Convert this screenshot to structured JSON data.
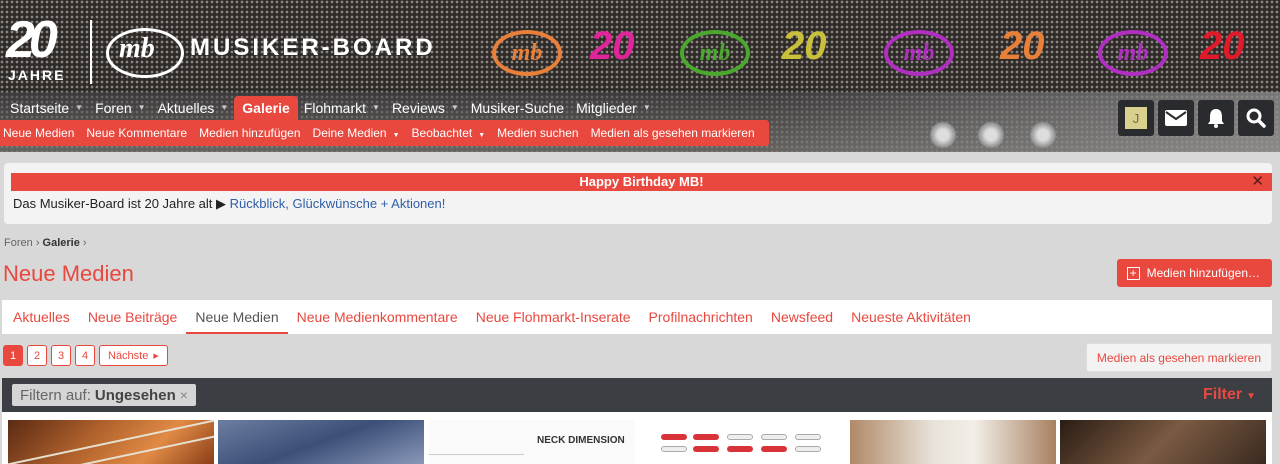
{
  "header": {
    "anniversary_number": "20",
    "anniversary_word": "JAHRE",
    "brand_mark": "mb",
    "brand_name": "MUSIKER-BOARD",
    "accent_color": "#e8483e"
  },
  "nav": {
    "items": [
      {
        "label": "Startseite"
      },
      {
        "label": "Foren"
      },
      {
        "label": "Aktuelles"
      },
      {
        "label": "Galerie",
        "active": true
      },
      {
        "label": "Flohmarkt"
      },
      {
        "label": "Reviews"
      },
      {
        "label": "Musiker-Suche"
      },
      {
        "label": "Mitglieder"
      }
    ]
  },
  "subnav": {
    "items": [
      {
        "label": "Neue Medien"
      },
      {
        "label": "Neue Kommentare"
      },
      {
        "label": "Medien hinzufügen"
      },
      {
        "label": "Deine Medien"
      },
      {
        "label": "Beobachtet"
      },
      {
        "label": "Medien suchen"
      },
      {
        "label": "Medien als gesehen markieren"
      }
    ]
  },
  "tools": {
    "avatar_letter": "J",
    "icons": [
      "envelope-icon",
      "bell-icon",
      "search-icon"
    ]
  },
  "notice": {
    "title": "Happy Birthday MB!",
    "close": "✕",
    "text": "Das Musiker-Board ist 20 Jahre alt",
    "link": "Rückblick, Glückwünsche + Aktionen!"
  },
  "breadcrumb": {
    "items": [
      "Foren",
      "Galerie"
    ]
  },
  "page": {
    "title": "Neue Medien",
    "add_button": "Medien hinzufügen…"
  },
  "tabs": {
    "items": [
      {
        "label": "Aktuelles"
      },
      {
        "label": "Neue Beiträge"
      },
      {
        "label": "Neue Medien",
        "active": true
      },
      {
        "label": "Neue Medienkommentare"
      },
      {
        "label": "Neue Flohmarkt-Inserate"
      },
      {
        "label": "Profilnachrichten"
      },
      {
        "label": "Newsfeed"
      },
      {
        "label": "Neueste Aktivitäten"
      }
    ]
  },
  "pager": {
    "pages": [
      "1",
      "2",
      "3",
      "4"
    ],
    "current": "1",
    "next": "Nächste"
  },
  "mark_seen": "Medien als gesehen markieren",
  "filter": {
    "prefix": "Filtern auf:",
    "value": "Ungesehen",
    "remove": "×",
    "toggle": "Filter"
  },
  "gallery": {
    "thumb3_label": "NECK DIMENSION"
  }
}
